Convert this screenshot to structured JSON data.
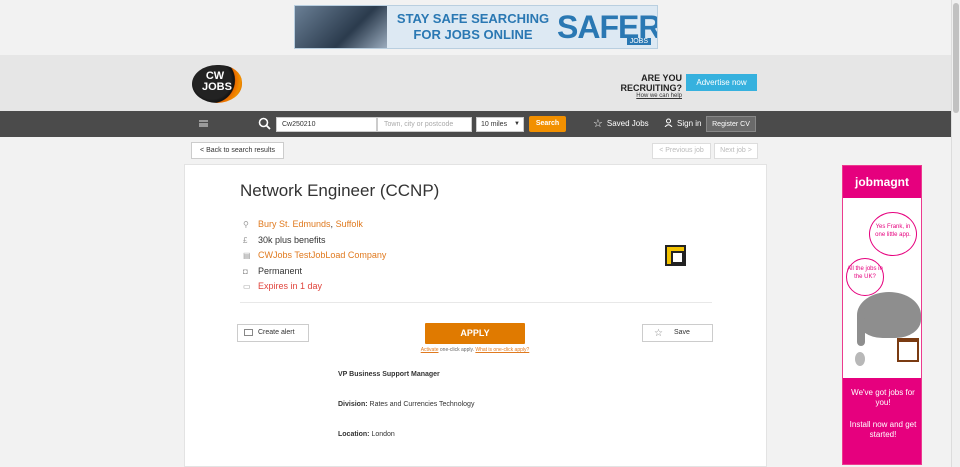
{
  "top_banner": {
    "line1": "STAY SAFE SEARCHING",
    "line2": "FOR JOBS ONLINE",
    "brand": "SAFER",
    "brand_tag": "JOBS"
  },
  "header": {
    "logo_text_1": "CW",
    "logo_text_2": "JOBS",
    "recruiting_question": "ARE YOU RECRUITING?",
    "how_we_can_help": "How we can help",
    "advertise_label": "Advertise now"
  },
  "navbar": {
    "keyword_value": "Cw250210",
    "location_placeholder": "Town, city or postcode",
    "miles_selected": "10 miles",
    "search_label": "Search",
    "saved_jobs_label": "Saved Jobs",
    "sign_in_label": "Sign in",
    "register_label": "Register CV"
  },
  "pagination": {
    "back_label": "< Back to search results",
    "prev_label": "< Previous job",
    "next_label": "Next job >"
  },
  "job": {
    "title": "Network Engineer (CCNP)",
    "location_town": "Bury St. Edmunds",
    "location_sep": ", ",
    "location_county": "Suffolk",
    "salary": "30k plus benefits",
    "company": "CWJobs TestJobLoad Company",
    "job_type": "Permanent",
    "expires": "Expires in 1 day"
  },
  "actions": {
    "create_alert_label": "Create alert",
    "apply_label": "APPLY",
    "activate_label": "Activate",
    "oneclick_text": " one-click apply. ",
    "what_is_label": "What is one-click apply?",
    "save_label": "Save"
  },
  "description": {
    "heading": "VP Business Support Manager",
    "division_label": "Division:",
    "division_value": " Rates and Currencies Technology",
    "location_label": "Location:",
    "location_value": " London"
  },
  "side_ad": {
    "brand": "jobmagnt",
    "bubble1": "Yes Frank, in one little app.",
    "bubble2": "All the jobs in the UK?",
    "tagline": "We've got jobs for you!",
    "cta": "Install now and get started!"
  },
  "icons": {
    "search": "search-icon",
    "star": "star-icon",
    "user": "user-icon",
    "menu": "menu-icon",
    "location": "location-pin-icon",
    "salary": "pound-icon",
    "company": "building-icon",
    "job_type": "briefcase-icon",
    "calendar": "calendar-icon",
    "mail": "mail-icon"
  },
  "colors": {
    "accent_orange": "#e07a00",
    "link_orange": "#e07a1f",
    "nav_bg": "#4b4b4b",
    "advertise_blue": "#36b1de",
    "expires_red": "#e0443c",
    "jobmagnt_pink": "#e6007e"
  }
}
